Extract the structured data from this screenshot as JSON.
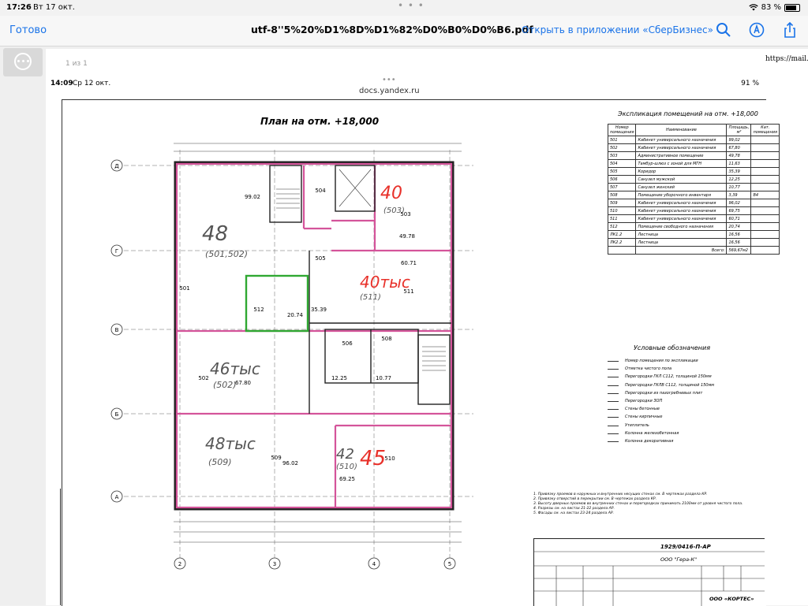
{
  "status_bar": {
    "time": "17:26",
    "date": "Вт 17 окт.",
    "battery": "83 %"
  },
  "nav": {
    "done_label": "Готово",
    "file_title": "utf-8''5%20%D1%8D%D1%82%D0%B0%D0%B6.pdf",
    "open_in_label": "Открыть в приложении «СберБизнес»",
    "icons": [
      "search-icon",
      "markup-icon",
      "share-icon"
    ]
  },
  "viewer": {
    "page_label": "1 из 1",
    "mail_url": "https://mail.go"
  },
  "inner_screenshot": {
    "time": "14:09",
    "date": "Ср 12 окт.",
    "battery": "91 %",
    "url": "docs.yandex.ru"
  },
  "drawing": {
    "title": "План на отм. +18,000",
    "explication_title": "Экспликация помещений на отм. +18,000",
    "table_headers": [
      "Номер помещения",
      "Наименование",
      "Площадь, м²",
      "Кат. помещения"
    ],
    "rooms": [
      [
        "501",
        "Кабинет универсального назначения",
        "99,02",
        ""
      ],
      [
        "502",
        "Кабинет универсального назначения",
        "67,80",
        ""
      ],
      [
        "503",
        "Административное помещение",
        "49,78",
        ""
      ],
      [
        "504",
        "Тамбур-шлюз с зоной для МГН",
        "11,63",
        ""
      ],
      [
        "505",
        "Коридор",
        "35,39",
        ""
      ],
      [
        "506",
        "Санузел мужской",
        "12,25",
        ""
      ],
      [
        "507",
        "Санузел женский",
        "10,77",
        ""
      ],
      [
        "508",
        "Помещение уборочного инвентаря",
        "3,39",
        "В4"
      ],
      [
        "509",
        "Кабинет универсального назначения",
        "96,02",
        ""
      ],
      [
        "510",
        "Кабинет универсального назначения",
        "69,75",
        ""
      ],
      [
        "511",
        "Кабинет универсального назначения",
        "60,71",
        ""
      ],
      [
        "512",
        "Помещение свободного назначения",
        "20,74",
        ""
      ],
      [
        "ЛК1.2",
        "Лестница",
        "16,56",
        ""
      ],
      [
        "ЛК2.2",
        "Лестница",
        "16,56",
        ""
      ]
    ],
    "total_label": "Всего:",
    "total_value": "569,67м2",
    "legend_title": "Условные обозначения",
    "legend_items": [
      "Номер помещения по экспликации",
      "Отметка чистого пола",
      "Перегородки ГКЛ С112, толщиной 150мм",
      "Перегородки ГКЛВ С112, толщиной 150мм",
      "Перегородки из пазогребневых плит",
      "Перегородки ЗОП",
      "Стены бетонные",
      "Стены кирпичные",
      "Утеплитель",
      "Колонна железобетонная",
      "Колонна декоративная"
    ],
    "notes": [
      "1. Привязку проемов в наружных и внутренних несущих стенах см. В чертежах раздела КР.",
      "2. Привязку отверстий в перекрытии см. В чертежах раздела КР.",
      "3. Высоту дверных проемов во внутренних стенах и перегородках принимать 2100мм от уровня чистого пола.",
      "4. Разрезы см. на листах 21-22 раздела АР.",
      "5. Фасады см. на листах 23-24 раздела АР."
    ],
    "stamp_code": "1929/0416-П-АР",
    "stamp_org": "ООО \"Гера-К\"",
    "stamp_company": "ООО «КОРТЕС»",
    "axes_letters": [
      "Д",
      "Г",
      "В",
      "Б",
      "А"
    ],
    "axes_numbers": [
      "2",
      "3",
      "4",
      "5"
    ],
    "room_labels": [
      {
        "id": "501",
        "area": "99.02"
      },
      {
        "id": "502",
        "area": "67.80"
      },
      {
        "id": "503",
        "area": "49.78"
      },
      {
        "id": "504",
        "area": ""
      },
      {
        "id": "505",
        "area": "35.39"
      },
      {
        "id": "506",
        "area": "12.25"
      },
      {
        "id": "508",
        "area": "10.77"
      },
      {
        "id": "509",
        "area": "96.02"
      },
      {
        "id": "510",
        "area": "69.25"
      },
      {
        "id": "511",
        "area": "60.71"
      },
      {
        "id": "512",
        "area": "20.74"
      }
    ],
    "handwritten": [
      "48",
      "(501,502)",
      "40",
      "(503)",
      "40тыс",
      "(511)",
      "46тыс",
      "(502)",
      "48тыс",
      "(509)",
      "42",
      "(510)",
      "45"
    ],
    "colors": {
      "pink": "#d4549a",
      "green": "#2fa832",
      "red_ink": "#e8312a",
      "black_ink": "#555555"
    }
  }
}
